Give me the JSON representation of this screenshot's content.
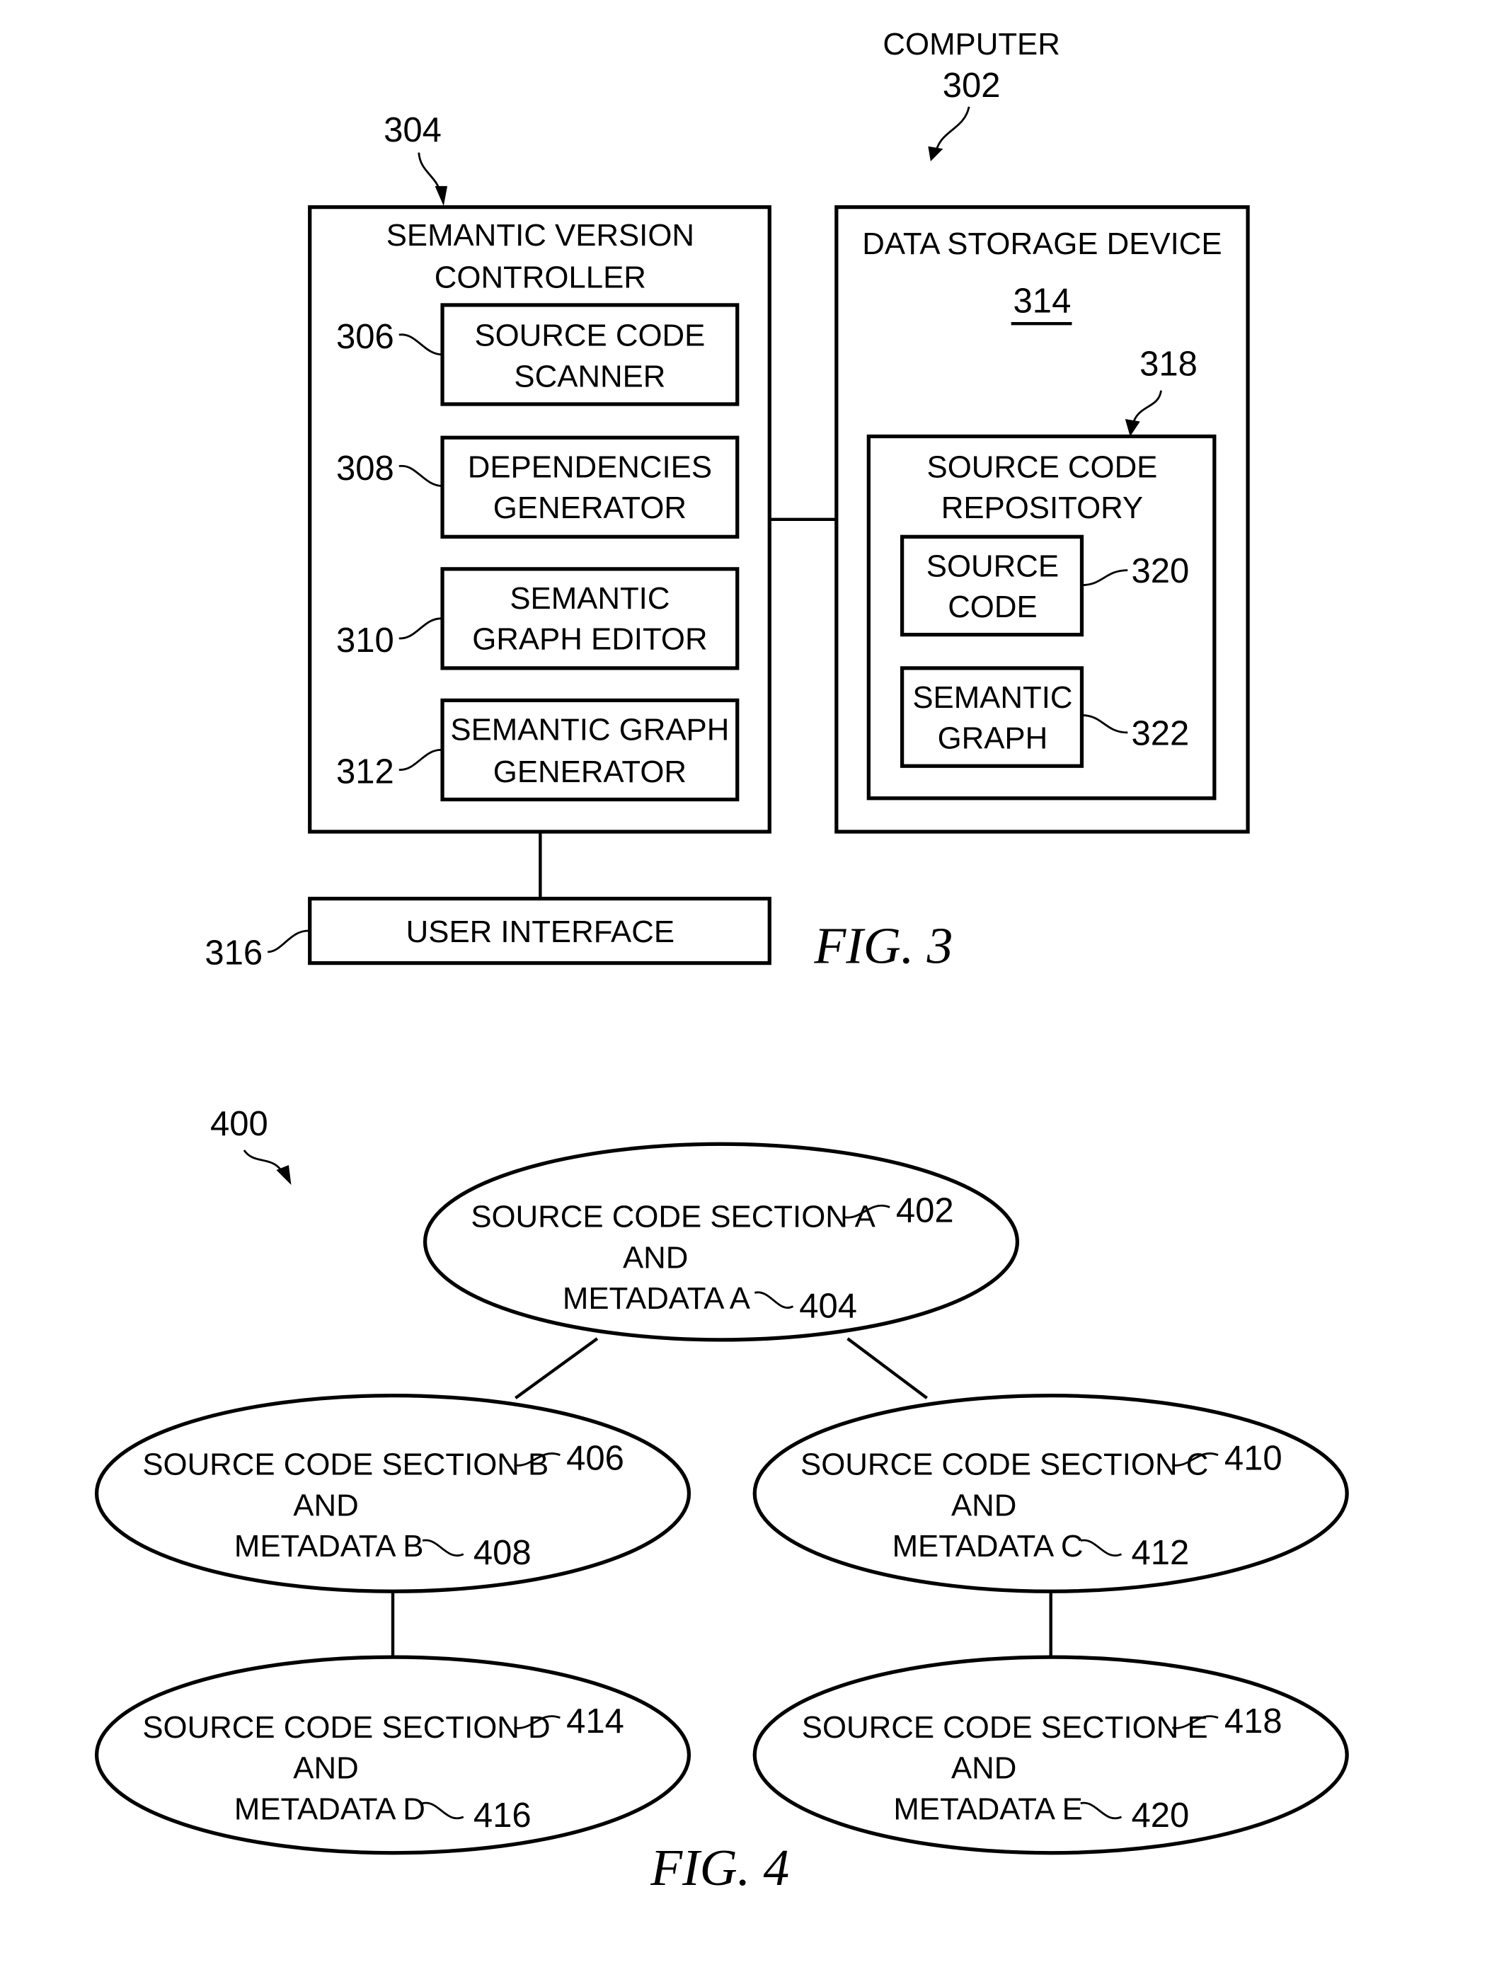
{
  "fig3": {
    "caption": "FIG. 3",
    "computer": {
      "label": "COMPUTER",
      "ref": "302"
    },
    "controller": {
      "line1": "SEMANTIC VERSION",
      "line2": "CONTROLLER",
      "ref": "304"
    },
    "scanner": {
      "line1": "SOURCE CODE",
      "line2": "SCANNER",
      "ref": "306"
    },
    "dependencies": {
      "line1": "DEPENDENCIES",
      "line2": "GENERATOR",
      "ref": "308"
    },
    "graph_editor": {
      "line1": "SEMANTIC",
      "line2": "GRAPH EDITOR",
      "ref": "310"
    },
    "graph_generator": {
      "line1": "SEMANTIC GRAPH",
      "line2": "GENERATOR",
      "ref": "312"
    },
    "storage": {
      "label": "DATA STORAGE DEVICE",
      "ref": "314"
    },
    "user_interface": {
      "label": "USER INTERFACE",
      "ref": "316"
    },
    "repository": {
      "line1": "SOURCE CODE",
      "line2": "REPOSITORY",
      "ref": "318"
    },
    "source_code": {
      "line1": "SOURCE",
      "line2": "CODE",
      "ref": "320"
    },
    "semantic_graph": {
      "line1": "SEMANTIC",
      "line2": "GRAPH",
      "ref": "322"
    }
  },
  "fig4": {
    "caption": "FIG. 4",
    "ref": "400",
    "nodes": [
      {
        "section": "SOURCE CODE SECTION A",
        "and": "AND",
        "metadata": "METADATA A",
        "section_ref": "402",
        "metadata_ref": "404"
      },
      {
        "section": "SOURCE CODE SECTION B",
        "and": "AND",
        "metadata": "METADATA B",
        "section_ref": "406",
        "metadata_ref": "408"
      },
      {
        "section": "SOURCE CODE SECTION C",
        "and": "AND",
        "metadata": "METADATA C",
        "section_ref": "410",
        "metadata_ref": "412"
      },
      {
        "section": "SOURCE CODE SECTION D",
        "and": "AND",
        "metadata": "METADATA D",
        "section_ref": "414",
        "metadata_ref": "416"
      },
      {
        "section": "SOURCE CODE SECTION E",
        "and": "AND",
        "metadata": "METADATA E",
        "section_ref": "418",
        "metadata_ref": "420"
      }
    ]
  }
}
